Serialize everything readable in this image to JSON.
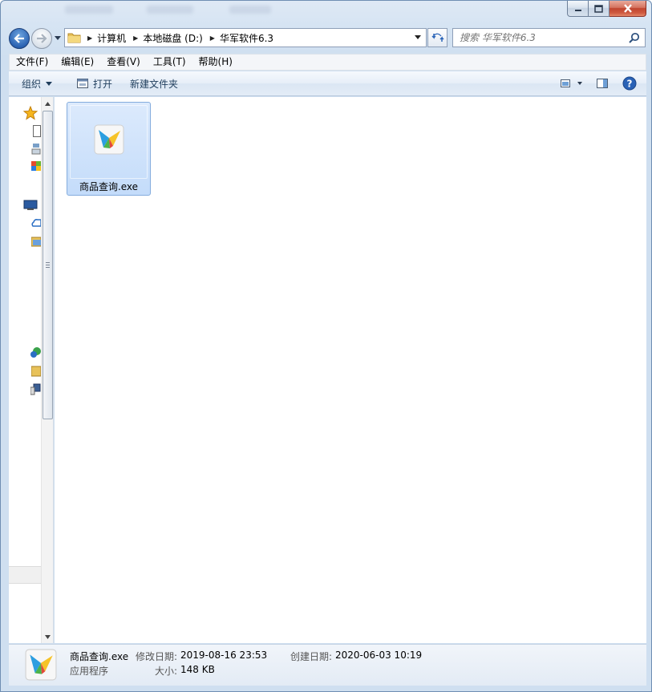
{
  "window": {
    "caption_buttons": [
      "minimize",
      "maximize",
      "close"
    ]
  },
  "address_bar": {
    "crumbs": [
      "计算机",
      "本地磁盘 (D:)",
      "华军软件6.3"
    ]
  },
  "search": {
    "placeholder": "搜索 华军软件6.3"
  },
  "menu": {
    "items": [
      "文件(F)",
      "编辑(E)",
      "查看(V)",
      "工具(T)",
      "帮助(H)"
    ]
  },
  "toolbar": {
    "organize_label": "组织",
    "open_label": "打开",
    "new_folder_label": "新建文件夹"
  },
  "files": [
    {
      "name": "商品查询.exe",
      "selected": true,
      "icon": "app-kite-icon"
    }
  ],
  "details": {
    "name": "商品查询.exe",
    "type": "应用程序",
    "modified_label": "修改日期:",
    "modified_value": "2019-08-16 23:53",
    "created_label": "创建日期:",
    "created_value": "2020-06-03 10:19",
    "size_label": "大小:",
    "size_value": "148 KB"
  },
  "colors": {
    "selection": "#c4dcfa",
    "selection_border": "#84acdd",
    "frame": "#cfdff0"
  }
}
